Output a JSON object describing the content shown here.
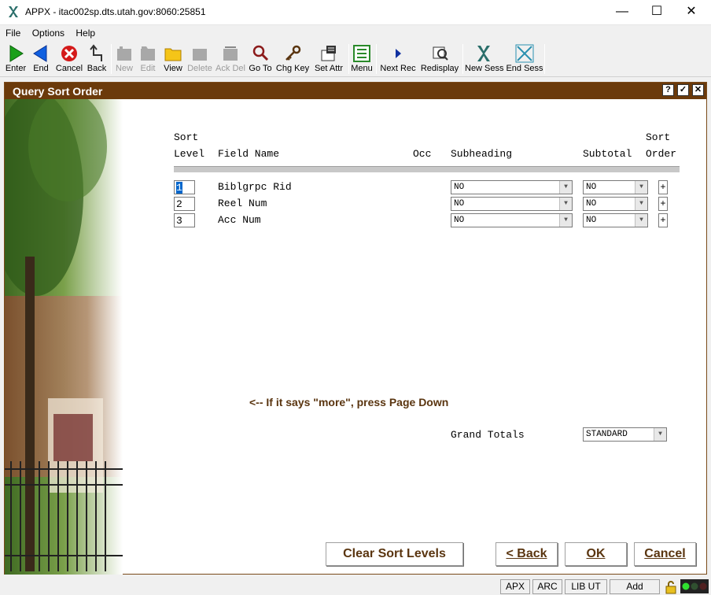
{
  "window": {
    "title": "APPX - itac002sp.dts.utah.gov:8060:25851",
    "minimize": "—",
    "maximize": "☐",
    "close": "✕"
  },
  "menu": [
    "File",
    "Options",
    "Help"
  ],
  "toolbar": {
    "enter": "Enter",
    "end": "End",
    "cancel": "Cancel",
    "back": "Back",
    "new": "New",
    "edit": "Edit",
    "view": "View",
    "delete": "Delete",
    "ack_del": "Ack Del",
    "go_to": "Go To",
    "chg_key": "Chg Key",
    "set_attr": "Set Attr",
    "menu": "Menu",
    "next_rec": "Next Rec",
    "redisplay": "Redisplay",
    "new_sess": "New Sess",
    "end_sess": "End Sess"
  },
  "panel": {
    "title": "Query Sort Order",
    "help_btn": "?",
    "ok_btn": "✓",
    "close_btn": "✕"
  },
  "columns": {
    "sort_top": "Sort",
    "level": "Level",
    "field_name": "Field Name",
    "occ": "Occ",
    "subheading": "Subheading",
    "subtotal": "Subtotal",
    "sort_top2": "Sort",
    "order": "Order"
  },
  "rows": [
    {
      "level": "1",
      "field": "Biblgrpc Rid",
      "subheading": "NO",
      "subtotal": "NO",
      "order": "+"
    },
    {
      "level": "2",
      "field": "Reel Num",
      "subheading": "NO",
      "subtotal": "NO",
      "order": "+"
    },
    {
      "level": "3",
      "field": "Acc Num",
      "subheading": "NO",
      "subtotal": "NO",
      "order": "+"
    }
  ],
  "hint": "<-- If it says \"more\", press Page Down",
  "grand_totals": {
    "label": "Grand Totals",
    "value": "STANDARD"
  },
  "buttons": {
    "clear": "Clear Sort Levels",
    "back": "< Back",
    "ok": "OK",
    "cancel": "Cancel"
  },
  "status": [
    "APX",
    "ARC",
    "LIB UT",
    "Add"
  ]
}
